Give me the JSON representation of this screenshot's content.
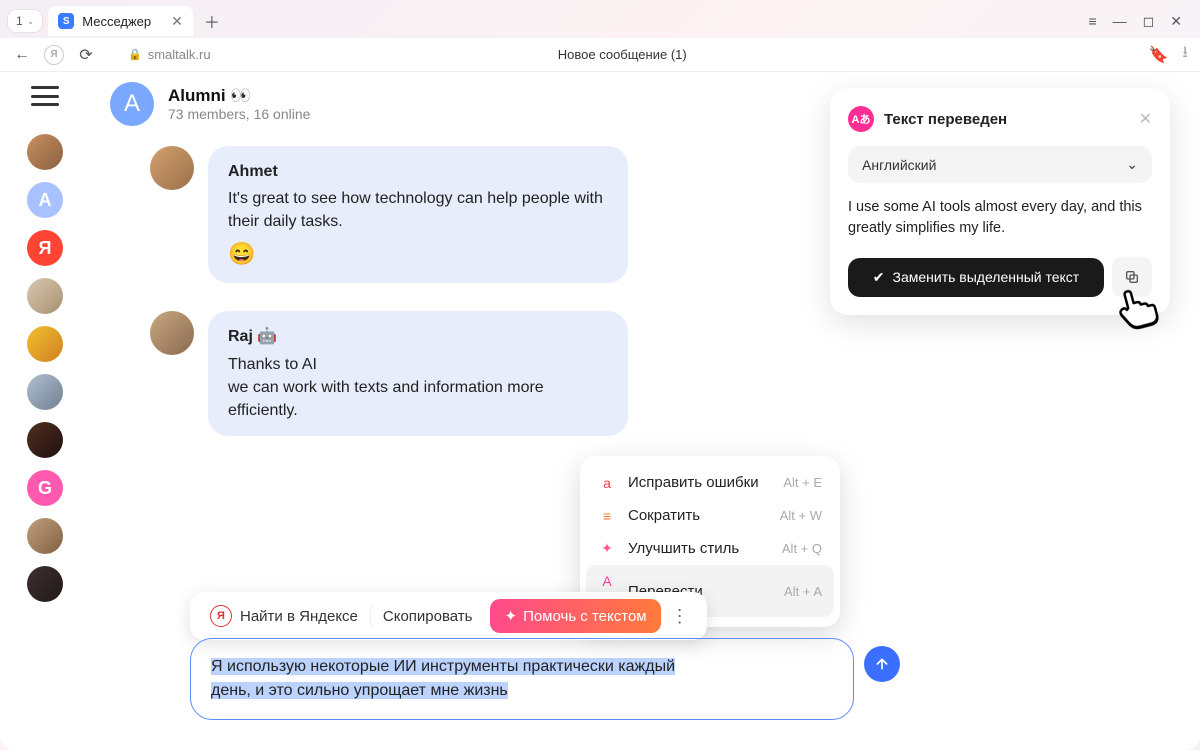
{
  "browser": {
    "tab_count": "1",
    "tab_title": "Месседжер",
    "url_host": "smaltalk.ru",
    "page_title": "Новое сообщение (1)"
  },
  "sidebar": {
    "items": [
      {
        "type": "photo",
        "bg": "linear-gradient(135deg,#c89060,#8a6040)"
      },
      {
        "type": "letter",
        "label": "A",
        "bg": "#a8c2ff"
      },
      {
        "type": "letter",
        "label": "Я",
        "bg": "#ff4433"
      },
      {
        "type": "photo",
        "bg": "linear-gradient(135deg,#d8c8b0,#a89070)"
      },
      {
        "type": "photo",
        "bg": "linear-gradient(135deg,#f0c030,#d08020)"
      },
      {
        "type": "photo",
        "bg": "linear-gradient(135deg,#b0c0d0,#708090)"
      },
      {
        "type": "photo",
        "bg": "linear-gradient(135deg,#503020,#201010)"
      },
      {
        "type": "letter",
        "label": "G",
        "bg": "#ff5ab0"
      },
      {
        "type": "photo",
        "bg": "linear-gradient(135deg,#c0a080,#806040)"
      },
      {
        "type": "photo",
        "bg": "linear-gradient(135deg,#403030,#201818)"
      }
    ]
  },
  "chat": {
    "group_letter": "А",
    "group_name": "Alumni 👀",
    "group_sub": "73 members, 16 online",
    "messages": [
      {
        "sender": "Ahmet",
        "text": "It's great to see how technology can help people with their daily tasks.",
        "emoji": "😄",
        "avatar_bg": "linear-gradient(135deg,#d4a070,#9a7048)"
      },
      {
        "sender": "Raj 🤖",
        "text": "Thanks to AI\nwe can work with texts and information more efficiently.",
        "avatar_bg": "linear-gradient(135deg,#c8a880,#8a6a50)"
      }
    ]
  },
  "action_bar": {
    "search_label": "Найти в Яндексе",
    "copy_label": "Скопировать",
    "help_label": "Помочь с текстом"
  },
  "context_menu": {
    "items": [
      {
        "icon": "a",
        "icon_color": "#ff3a4a",
        "label": "Исправить ошибки",
        "shortcut": "Alt + E"
      },
      {
        "icon": "≡",
        "icon_color": "#ff7a3a",
        "label": "Сократить",
        "shortcut": "Alt + W"
      },
      {
        "icon": "✦",
        "icon_color": "#ff5a9a",
        "label": "Улучшить стиль",
        "shortcut": "Alt + Q"
      },
      {
        "icon": "Aあ",
        "icon_color": "#ff3a94",
        "label": "Перевести",
        "shortcut": "Alt + A",
        "active": true
      }
    ]
  },
  "compose": {
    "line1": "Я использую некоторые ИИ инструменты практически каждый",
    "line2_sel": "день, и это сильно упрощает мне жизнь"
  },
  "translation": {
    "title": "Текст переведен",
    "language": "Английский",
    "body": "I use some AI tools almost every day, and this greatly simplifies my life.",
    "replace_label": "Заменить выделенный текст"
  }
}
